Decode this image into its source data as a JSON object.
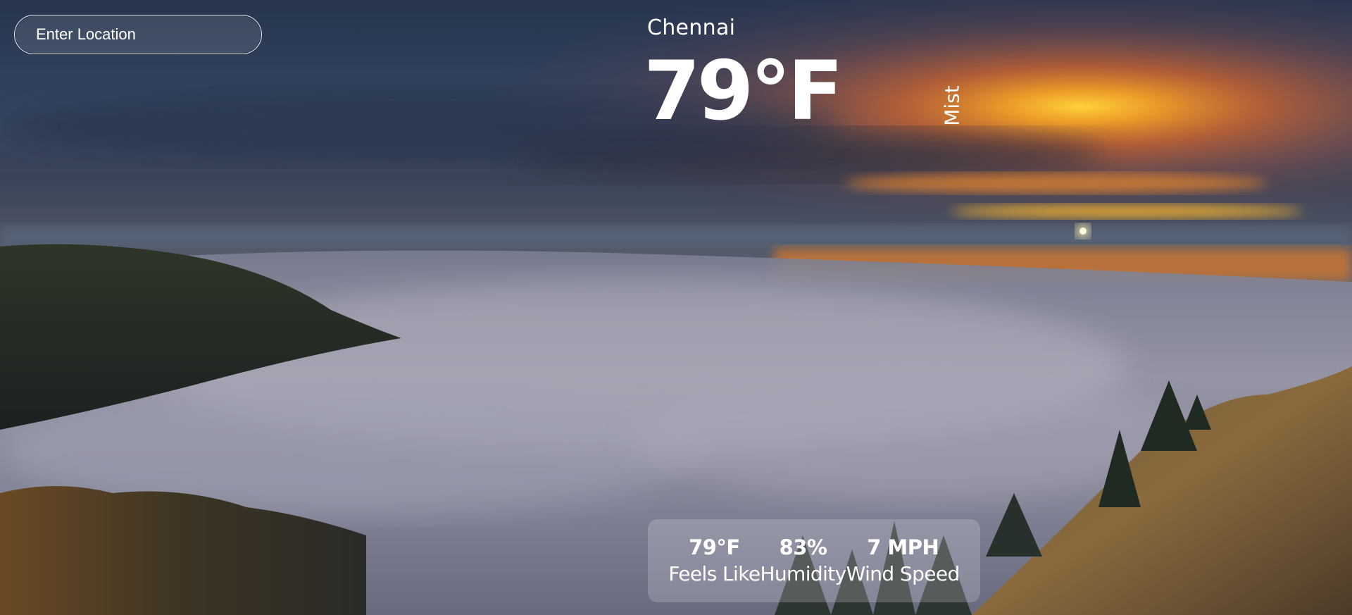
{
  "search": {
    "placeholder": "Enter Location"
  },
  "weather": {
    "location": "Chennai",
    "temperature": "79°F",
    "description": "Mist"
  },
  "stats": [
    {
      "value": "79°F",
      "label": "Feels Like"
    },
    {
      "value": "83%",
      "label": "Humidity"
    },
    {
      "value": "7 MPH",
      "label": "Wind Speed"
    }
  ],
  "theme": {
    "text_color": "#ffffff",
    "panel_color": "#e6e6f0"
  }
}
